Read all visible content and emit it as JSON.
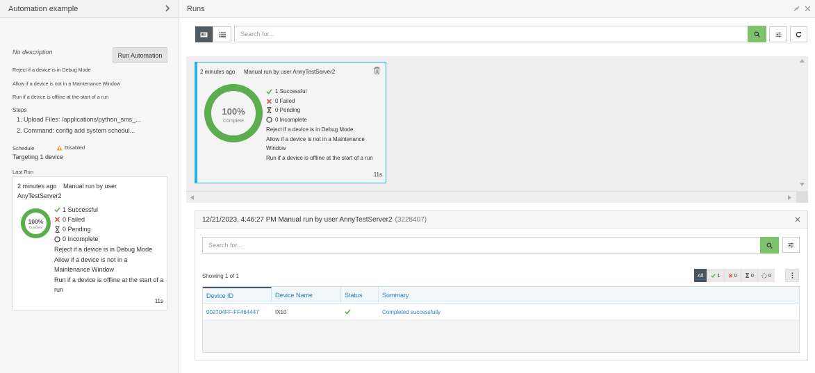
{
  "left": {
    "title": "Automation example",
    "description": "No description",
    "run_button": "Run Automation",
    "conditions": [
      "Reject if a device is in Debug Mode",
      "Allow if a device is not in a Maintenance Window",
      "Run if a device is offline at the start of a run"
    ],
    "steps_label": "Steps",
    "steps": [
      "1. Upload Files: /applications/python_sms_...",
      "2. Command: config add system schedul..."
    ],
    "schedule_label": "Schedule",
    "schedule_status": "Disabled",
    "targeting": "Targeting 1 device",
    "last_run_label": "Last Run",
    "last_run": {
      "time": "2 minutes ago",
      "by_line1": "Manual run by user",
      "by_line2": "AnyTestServer2",
      "percent": "100%",
      "complete": "Complete",
      "successful": "1 Successful",
      "failed": "0 Failed",
      "pending": "0 Pending",
      "incomplete": "0 Incomplete",
      "cond1": "Reject if a device is in Debug Mode",
      "cond2a": "Allow if a device is not in a",
      "cond2b": "Maintenance Window",
      "cond3a": "Run if a device is offline at the start of a",
      "cond3b": "run",
      "duration": "11s"
    }
  },
  "right": {
    "title": "Runs",
    "search_placeholder": "Search for...",
    "run_card": {
      "time": "2 minutes ago",
      "by": "Manual run by user AnnyTestServer2",
      "percent": "100%",
      "complete": "Complete",
      "successful": "1 Successful",
      "failed": "0 Failed",
      "pending": "0 Pending",
      "incomplete": "0 Incomplete",
      "cond1": "Reject if a device is in Debug Mode",
      "cond2a": "Allow if a device is not in a Maintenance",
      "cond2b": "Window",
      "cond3": "Run if a device is offline at the start of a run",
      "duration": "11s"
    },
    "detail": {
      "title": "12/21/2023, 4:46:27 PM Manual run by user AnnyTestServer2",
      "run_id": "(3228407)",
      "search_placeholder": "Search for...",
      "showing": "Showing 1 of 1",
      "filters": {
        "all": "All",
        "success_count": "1",
        "failed_count": "0",
        "pending_count": "0",
        "incomplete_count": "0"
      },
      "columns": [
        "Device ID",
        "Device Name",
        "Status",
        "Summary"
      ],
      "rows": [
        {
          "device_id": "002704FF-FF464447",
          "device_name": "IX10",
          "summary": "Completed successfully"
        }
      ]
    }
  },
  "colors": {
    "success": "#5cad4d",
    "failed": "#d9534f",
    "accent": "#2bb1e8",
    "search_button": "#7dc36b",
    "link": "#2c7fb8"
  },
  "progress": {
    "fraction_complete": 1.0
  }
}
